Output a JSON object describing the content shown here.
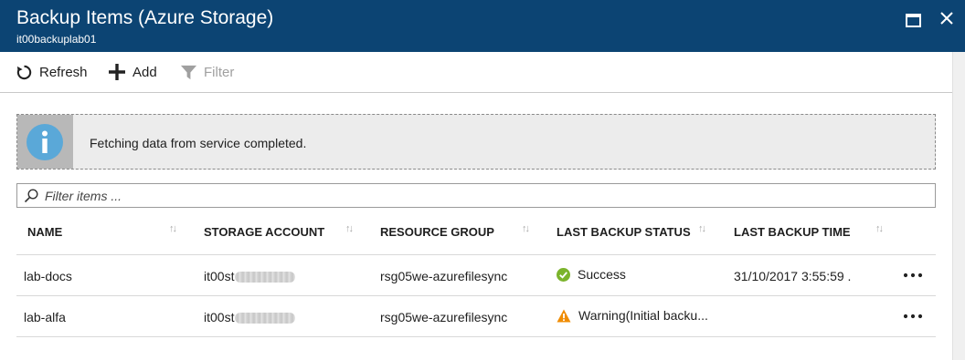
{
  "window": {
    "title": "Backup Items (Azure Storage)",
    "subtitle": "it00backuplab01",
    "icons": {
      "maximize": "maximize-icon",
      "close": "close-icon"
    }
  },
  "toolbar": {
    "refresh_label": "Refresh",
    "add_label": "Add",
    "filter_label": "Filter"
  },
  "info": {
    "message": "Fetching data from service completed."
  },
  "search": {
    "placeholder": "Filter items ..."
  },
  "table": {
    "columns": [
      "NAME",
      "STORAGE ACCOUNT",
      "RESOURCE GROUP",
      "LAST BACKUP STATUS",
      "LAST BACKUP TIME"
    ],
    "rows": [
      {
        "name": "lab-docs",
        "storage_account": "it00st",
        "resource_group": "rsg05we-azurefilesync",
        "status": "Success",
        "status_icon": "success-check-icon",
        "last_backup_time": "31/10/2017 3:55:59 ."
      },
      {
        "name": "lab-alfa",
        "storage_account": "it00st",
        "resource_group": "rsg05we-azurefilesync",
        "status": "Warning(Initial backu...",
        "status_icon": "warning-icon",
        "last_backup_time": ""
      }
    ]
  },
  "colors": {
    "titlebar": "#0c4473",
    "success": "#7bb42c",
    "warning": "#f08c00",
    "info_icon": "#5aa8d8"
  }
}
